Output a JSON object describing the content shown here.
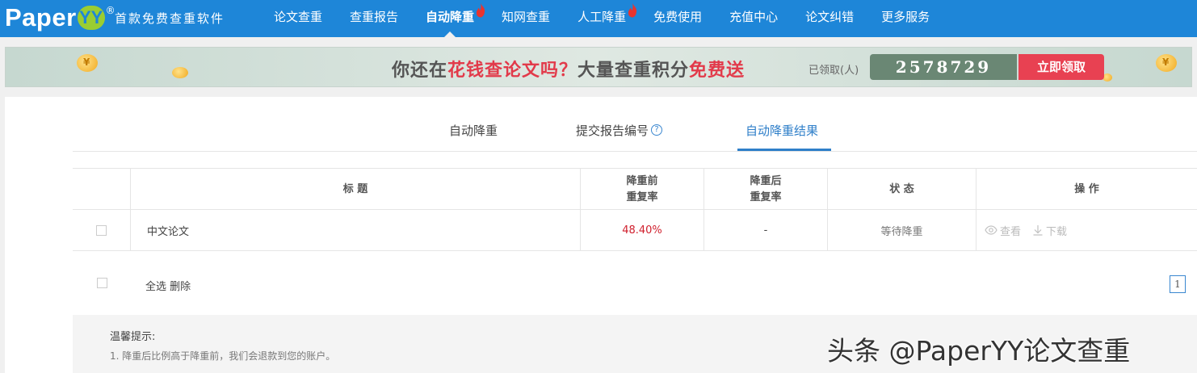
{
  "header": {
    "logo_text": "Paper",
    "logo_mark": "YY",
    "logo_reg": "®",
    "slogan": "首款免费查重软件",
    "nav": [
      {
        "label": "论文查重",
        "hot": false,
        "active": false
      },
      {
        "label": "查重报告",
        "hot": false,
        "active": false
      },
      {
        "label": "自动降重",
        "hot": true,
        "active": true
      },
      {
        "label": "知网查重",
        "hot": false,
        "active": false
      },
      {
        "label": "人工降重",
        "hot": true,
        "active": false
      },
      {
        "label": "免费使用",
        "hot": false,
        "active": false
      },
      {
        "label": "充值中心",
        "hot": false,
        "active": false
      },
      {
        "label": "论文纠错",
        "hot": false,
        "active": false
      },
      {
        "label": "更多服务",
        "hot": false,
        "active": false
      }
    ],
    "hot_icon": "flame-icon"
  },
  "banner": {
    "text_1": "你还在",
    "text_2": "花钱查论文吗？",
    "text_3": "大量查重积分",
    "text_4": "免费送",
    "claimed_label": "已领取(人)",
    "claimed_count": "2578729",
    "claim_button": "立即领取",
    "coin_mark": "¥"
  },
  "tabs": [
    {
      "label": "自动降重",
      "active": false
    },
    {
      "label": "提交报告编号",
      "active": false,
      "help": "?"
    },
    {
      "label": "自动降重结果",
      "active": true
    }
  ],
  "table": {
    "headers": {
      "title": "标 题",
      "before_1": "降重前",
      "before_2": "重复率",
      "after_1": "降重后",
      "after_2": "重复率",
      "status": "状 态",
      "ops": "操 作"
    },
    "rows": [
      {
        "title": "中文论文",
        "before_rate": "48.40%",
        "after_rate": "-",
        "status": "等待降重",
        "view": "查看",
        "download": "下载"
      }
    ]
  },
  "footer": {
    "select_all": "全选",
    "delete": "删除",
    "page": "1"
  },
  "tips": {
    "title": "温馨提示:",
    "line_1": "1. 降重后比例高于降重前，我们会退款到您的账户。"
  },
  "watermark": "头条 @PaperYY论文查重",
  "colors": {
    "header_bg": "#1e86d8",
    "accent_blue": "#2f7fc9",
    "rate_red": "#d0202e",
    "claim_red": "#e84152",
    "counter_green": "#6a8774"
  }
}
